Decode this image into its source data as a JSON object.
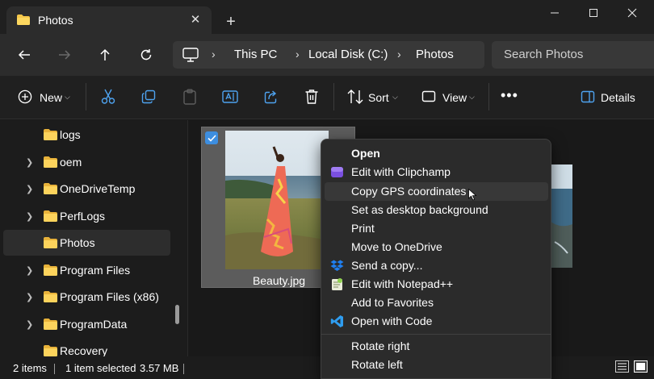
{
  "window": {
    "tab_title": "Photos",
    "tab_close": "✕",
    "new_tab": "+"
  },
  "address": {
    "crumbs": [
      "This PC",
      "Local Disk (C:)",
      "Photos"
    ],
    "separator": "›"
  },
  "search": {
    "placeholder": "Search Photos"
  },
  "commandbar": {
    "new_label": "New",
    "sort_label": "Sort",
    "view_label": "View",
    "more": "•••",
    "details_label": "Details"
  },
  "sidebar": {
    "items": [
      {
        "label": "logs",
        "has_chevron": false,
        "selected": false
      },
      {
        "label": "oem",
        "has_chevron": true,
        "selected": false
      },
      {
        "label": "OneDriveTemp",
        "has_chevron": true,
        "selected": false
      },
      {
        "label": "PerfLogs",
        "has_chevron": true,
        "selected": false
      },
      {
        "label": "Photos",
        "has_chevron": false,
        "selected": true
      },
      {
        "label": "Program Files",
        "has_chevron": true,
        "selected": false
      },
      {
        "label": "Program Files (x86)",
        "has_chevron": true,
        "selected": false
      },
      {
        "label": "ProgramData",
        "has_chevron": true,
        "selected": false
      },
      {
        "label": "Recovery",
        "has_chevron": false,
        "selected": false
      }
    ]
  },
  "content": {
    "files": [
      {
        "name": "Beauty.jpg",
        "selected": true
      }
    ]
  },
  "status": {
    "item_count": "2 items",
    "selection": "1 item selected",
    "size": "3.57 MB"
  },
  "context_menu": {
    "items": [
      {
        "label": "Open",
        "bold": true,
        "icon": "none"
      },
      {
        "label": "Edit with Clipchamp",
        "icon": "clipchamp-icon"
      },
      {
        "label": "Copy GPS coordinates",
        "icon": "none",
        "hover": true
      },
      {
        "label": "Set as desktop background",
        "icon": "none"
      },
      {
        "label": "Print",
        "icon": "none"
      },
      {
        "label": "Move to OneDrive",
        "icon": "none"
      },
      {
        "label": "Send a copy...",
        "icon": "dropbox-icon"
      },
      {
        "label": "Edit with Notepad++",
        "icon": "notepadpp-icon"
      },
      {
        "label": "Add to Favorites",
        "icon": "none"
      },
      {
        "label": "Open with Code",
        "icon": "vscode-icon"
      },
      {
        "label": "Rotate right",
        "icon": "none"
      },
      {
        "label": "Rotate left",
        "icon": "none"
      }
    ]
  },
  "colors": {
    "accent": "#3d8ee0",
    "folder": "#f5c74a",
    "background": "#191919",
    "menu": "#2b2b2b"
  }
}
